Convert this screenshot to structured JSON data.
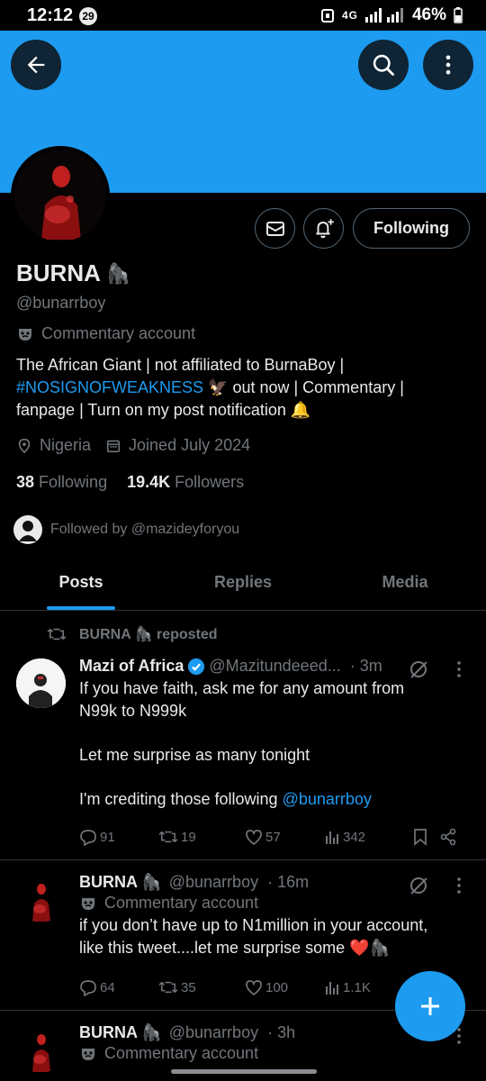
{
  "status": {
    "time": "12:12",
    "notif_count": "29",
    "network": "4G",
    "battery": "46%"
  },
  "profile": {
    "name": "BURNA",
    "name_emoji": "🦍",
    "handle": "@bunarrboy",
    "label": "Commentary account",
    "bio_line1": "The African Giant | not affiliated to BurnaBoy |",
    "bio_hashtag": "#NOSIGNOFWEAKNESS",
    "bio_line2": " 🦅 out now | Commentary |",
    "bio_line3": "fanpage | Turn on my post notification 🔔",
    "location": "Nigeria",
    "joined": "Joined July 2024",
    "following_count": "38",
    "following_label": "Following",
    "followers_count": "19.4K",
    "followers_label": "Followers",
    "followed_by": "Followed by @mazideyforyou",
    "following_button": "Following"
  },
  "tabs": [
    "Posts",
    "Replies",
    "Media"
  ],
  "tweets": [
    {
      "repost_by": "BURNA 🦍 reposted",
      "name": "Mazi of Africa",
      "verified": true,
      "handle": "@Mazitundeeed...",
      "time": "· 3m",
      "text1": "If you have faith, ask me for any amount from",
      "text2": "N99k to N999k",
      "text3": "Let me surprise as many tonight",
      "text4": "I'm crediting those following ",
      "mention": "@bunarrboy",
      "replies": "91",
      "reposts": "19",
      "likes": "57",
      "views": "342"
    },
    {
      "name": "BURNA 🦍",
      "handle": "@bunarrboy",
      "time": "· 16m",
      "label": "Commentary account",
      "text1": "if you don’t have up to N1million in your account,",
      "text2": "like this tweet....let me surprise some ❤️🦍",
      "replies": "64",
      "reposts": "35",
      "likes": "100",
      "views": "1.1K"
    },
    {
      "name": "BURNA 🦍",
      "handle": "@bunarrboy",
      "time": "· 3h",
      "label": "Commentary account"
    }
  ],
  "colors": {
    "accent": "#1d9bf0",
    "banner": "#1d9bf0",
    "muted": "#71767b"
  }
}
